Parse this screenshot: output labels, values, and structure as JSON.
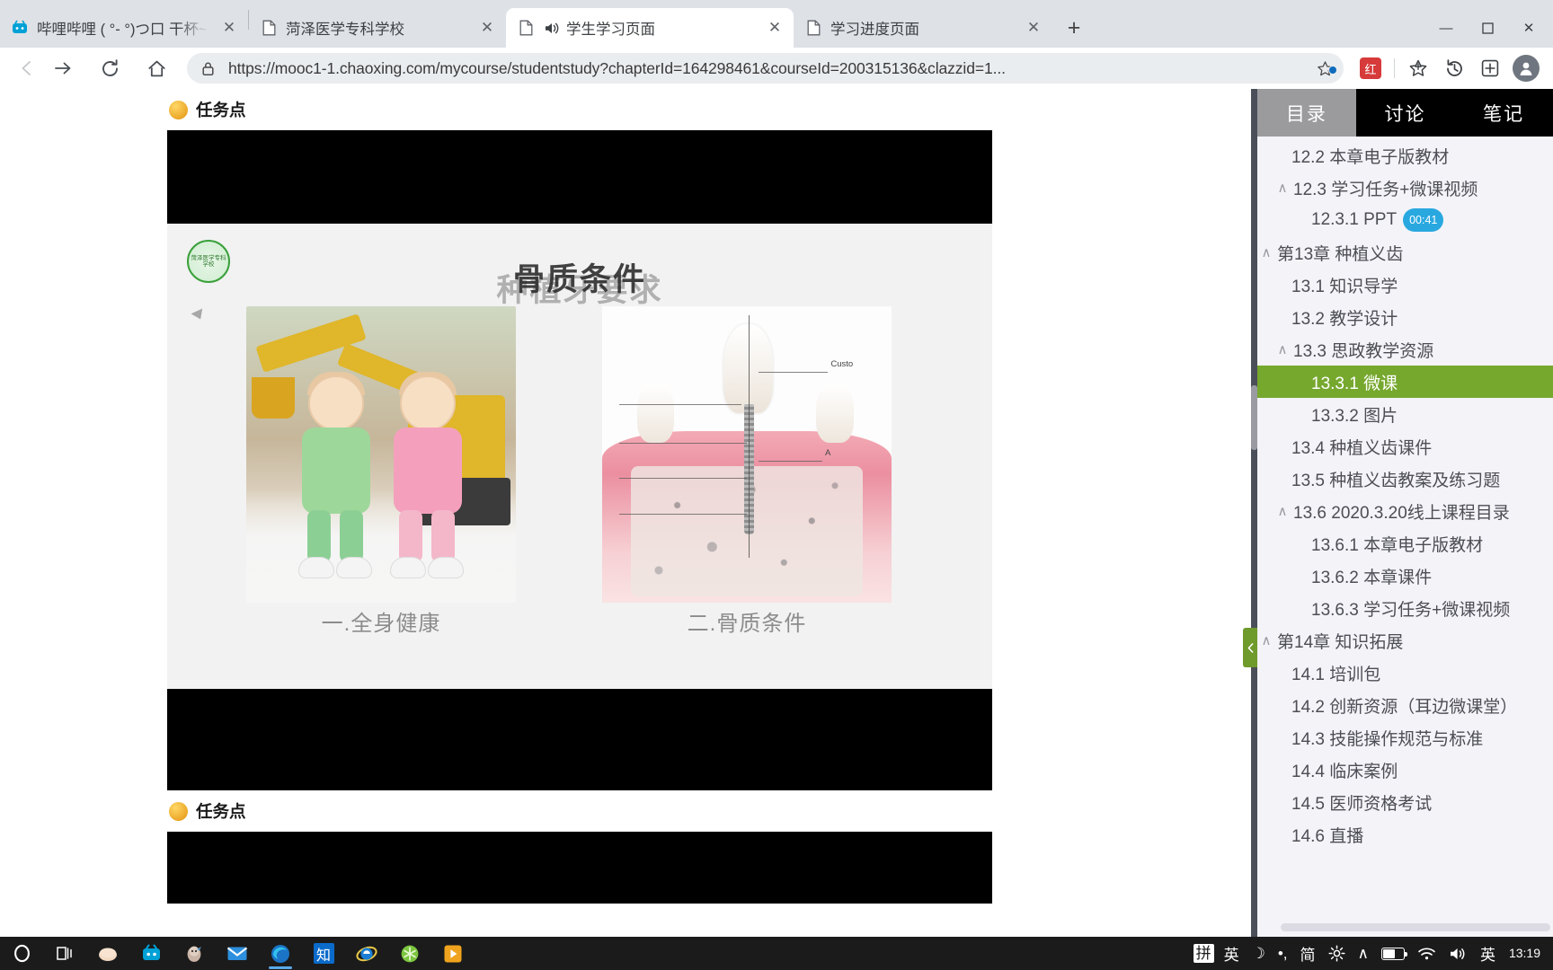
{
  "browser": {
    "tabs": [
      {
        "title": "哔哩哔哩 ( °- °)つ口 干杯~-bilib",
        "favicon": "bilibili-icon",
        "active": false,
        "audio": false
      },
      {
        "title": "菏泽医学专科学校",
        "favicon": "page-icon",
        "active": false,
        "audio": false
      },
      {
        "title": "学生学习页面",
        "favicon": "page-icon",
        "active": true,
        "audio": true
      },
      {
        "title": "学习进度页面",
        "favicon": "page-icon",
        "active": false,
        "audio": false
      }
    ],
    "close_label": "✕",
    "newtab_label": "+",
    "window_controls": {
      "minimize": "—",
      "maximize": "▫",
      "close": "✕"
    },
    "nav": {
      "back": "←",
      "forward": "→",
      "reload": "⟳",
      "home": "⌂"
    },
    "url": "https://mooc1-1.chaoxing.com/mycourse/studentstudy?chapterId=164298461&courseId=200315136&clazzid=1...",
    "lock_icon": "lock-icon",
    "star_icon": "star-icon",
    "toolbar_icons": {
      "extension": "红",
      "favorites": "☆",
      "history": "⟲",
      "collections": "⊞",
      "profile": "person-icon"
    }
  },
  "main": {
    "task_sections": [
      {
        "label": "任务点"
      },
      {
        "label": "任务点"
      }
    ],
    "slide": {
      "title_front": "骨质条件",
      "title_back": "种植牙要求",
      "logo_text": "菏泽医学专科学校",
      "caption_left": "一.全身健康",
      "caption_right": "二.骨质条件",
      "implant_labels": [
        "Custo",
        "A"
      ]
    }
  },
  "sidebar": {
    "tabs": [
      {
        "label": "目录",
        "active": true
      },
      {
        "label": "讨论",
        "active": false
      },
      {
        "label": "笔记",
        "active": false
      }
    ],
    "collapse_icon": "chevron-left-icon",
    "items": [
      {
        "text": "12.2 本章电子版教材",
        "level": 2,
        "caret": false,
        "selected": false
      },
      {
        "text": "12.3 学习任务+微课视频",
        "level": 2,
        "caret": true,
        "selected": false
      },
      {
        "text": "12.3.1 PPT",
        "level": 3,
        "caret": false,
        "selected": false,
        "badge": "00:41"
      },
      {
        "text": "第13章 种植义齿",
        "level": 1,
        "caret": true,
        "selected": false
      },
      {
        "text": "13.1 知识导学",
        "level": 2,
        "caret": false,
        "selected": false
      },
      {
        "text": "13.2 教学设计",
        "level": 2,
        "caret": false,
        "selected": false
      },
      {
        "text": "13.3 思政教学资源",
        "level": 2,
        "caret": true,
        "selected": false
      },
      {
        "text": "13.3.1 微课",
        "level": 3,
        "caret": false,
        "selected": true
      },
      {
        "text": "13.3.2 图片",
        "level": 3,
        "caret": false,
        "selected": false
      },
      {
        "text": "13.4 种植义齿课件",
        "level": 2,
        "caret": false,
        "selected": false
      },
      {
        "text": "13.5 种植义齿教案及练习题",
        "level": 2,
        "caret": false,
        "selected": false
      },
      {
        "text": "13.6 2020.3.20线上课程目录",
        "level": 2,
        "caret": true,
        "selected": false
      },
      {
        "text": "13.6.1 本章电子版教材",
        "level": 3,
        "caret": false,
        "selected": false
      },
      {
        "text": "13.6.2 本章课件",
        "level": 3,
        "caret": false,
        "selected": false
      },
      {
        "text": "13.6.3 学习任务+微课视频",
        "level": 3,
        "caret": false,
        "selected": false
      },
      {
        "text": "第14章 知识拓展",
        "level": 1,
        "caret": true,
        "selected": false
      },
      {
        "text": "14.1 培训包",
        "level": 2,
        "caret": false,
        "selected": false
      },
      {
        "text": "14.2 创新资源（耳边微课堂）",
        "level": 2,
        "caret": false,
        "selected": false
      },
      {
        "text": "14.3 技能操作规范与标准",
        "level": 2,
        "caret": false,
        "selected": false
      },
      {
        "text": "14.4 临床案例",
        "level": 2,
        "caret": false,
        "selected": false
      },
      {
        "text": "14.5 医师资格考试",
        "level": 2,
        "caret": false,
        "selected": false
      },
      {
        "text": "14.6 直播",
        "level": 2,
        "caret": false,
        "selected": false
      }
    ]
  },
  "taskbar": {
    "start_icon": "start-circle-icon",
    "apps": [
      {
        "name": "task-view-icon",
        "glyph": "目|"
      },
      {
        "name": "steam-icon",
        "glyph": "◓"
      },
      {
        "name": "bilibili-icon",
        "glyph": "📺"
      },
      {
        "name": "qq-icon",
        "glyph": "🐧"
      },
      {
        "name": "mail-icon",
        "glyph": "✉"
      },
      {
        "name": "edge-icon",
        "glyph": "◑",
        "running": true
      },
      {
        "name": "zhihu-icon",
        "glyph": "知"
      },
      {
        "name": "internet-explorer-icon",
        "glyph": "ℯ"
      },
      {
        "name": "wps-icon",
        "glyph": "✳"
      },
      {
        "name": "media-player-icon",
        "glyph": "▶"
      }
    ],
    "tray": {
      "ime_mode": "拼",
      "ime_lang": "英",
      "moon": "☽",
      "dot": "•,",
      "simplified": "简",
      "settings": "gear-icon",
      "overflow": "∧",
      "battery": "battery-icon",
      "speaker": "speaker-icon",
      "network": "network-icon",
      "lang_badge": "英",
      "time": "13:19"
    }
  }
}
